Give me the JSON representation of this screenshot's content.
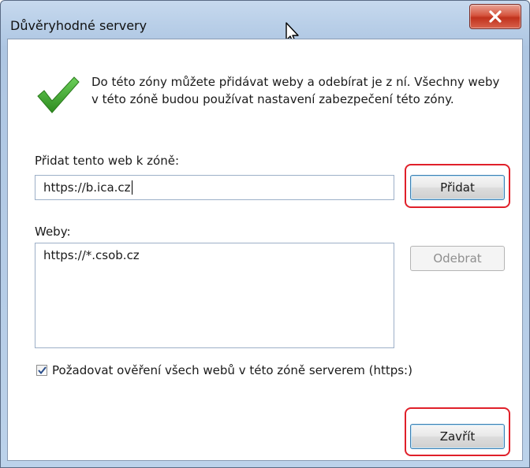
{
  "window": {
    "title": "Důvěryhodné servery"
  },
  "info_text": "Do této zóny můžete přidávat weby a odebírat je z ní. Všechny weby v této zóně budou používat nastavení zabezpečení této zóny.",
  "add_section": {
    "label": "Přidat tento web k zóně:",
    "url_value": "https://b.ica.cz",
    "add_button": "Přidat"
  },
  "sites_section": {
    "label": "Weby:",
    "items": [
      "https://*.csob.cz"
    ],
    "remove_button": "Odebrat"
  },
  "require_https": {
    "label": "Požadovat ověření všech webů v této zóně serverem (https:)",
    "checked": true
  },
  "close_button": "Zavřít",
  "icons": {
    "check": "checkmark-icon",
    "close": "close-x-icon",
    "cursor": "mouse-cursor-icon"
  },
  "colors": {
    "highlight": "#e0202a",
    "check_green": "#3a9a2a",
    "close_red": "#c0321d"
  }
}
